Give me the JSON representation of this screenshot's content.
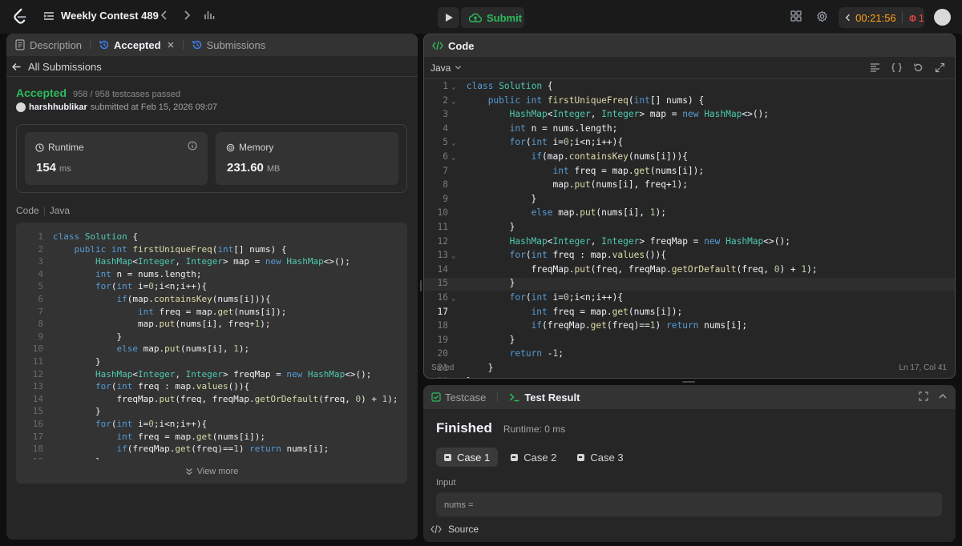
{
  "topbar": {
    "contest_title": "Weekly Contest 489",
    "submit_label": "Submit",
    "timer": "00:21:56",
    "notif_count": "1"
  },
  "left": {
    "tabs": [
      {
        "label": "Description"
      },
      {
        "label": "Accepted"
      },
      {
        "label": "Submissions"
      }
    ],
    "back_label": "All Submissions",
    "status": "Accepted",
    "testcases": "958 / 958 testcases passed",
    "username": "harshhublikar",
    "submitted_at": "submitted at Feb 15, 2026 09:07",
    "runtime": {
      "label": "Runtime",
      "value": "154",
      "unit": "ms"
    },
    "memory": {
      "label": "Memory",
      "value": "231.60",
      "unit": "MB"
    },
    "code_label": "Code",
    "lang_label": "Java",
    "view_more": "View more"
  },
  "editor": {
    "title": "Code",
    "language": "Java",
    "saved": "Saved",
    "cursor": "Ln 17, Col 41",
    "current_line": 17
  },
  "bottom": {
    "tabs": [
      {
        "label": "Testcase"
      },
      {
        "label": "Test Result"
      }
    ],
    "status": "Finished",
    "runtime": "Runtime: 0 ms",
    "cases": [
      "Case 1",
      "Case 2",
      "Case 3"
    ],
    "input_label": "Input",
    "input_value": "nums =",
    "source_label": "Source"
  },
  "colors": {
    "accent_green": "#2cbb5d",
    "timer_orange": "#ffa116",
    "notif_red": "#ef4743"
  }
}
